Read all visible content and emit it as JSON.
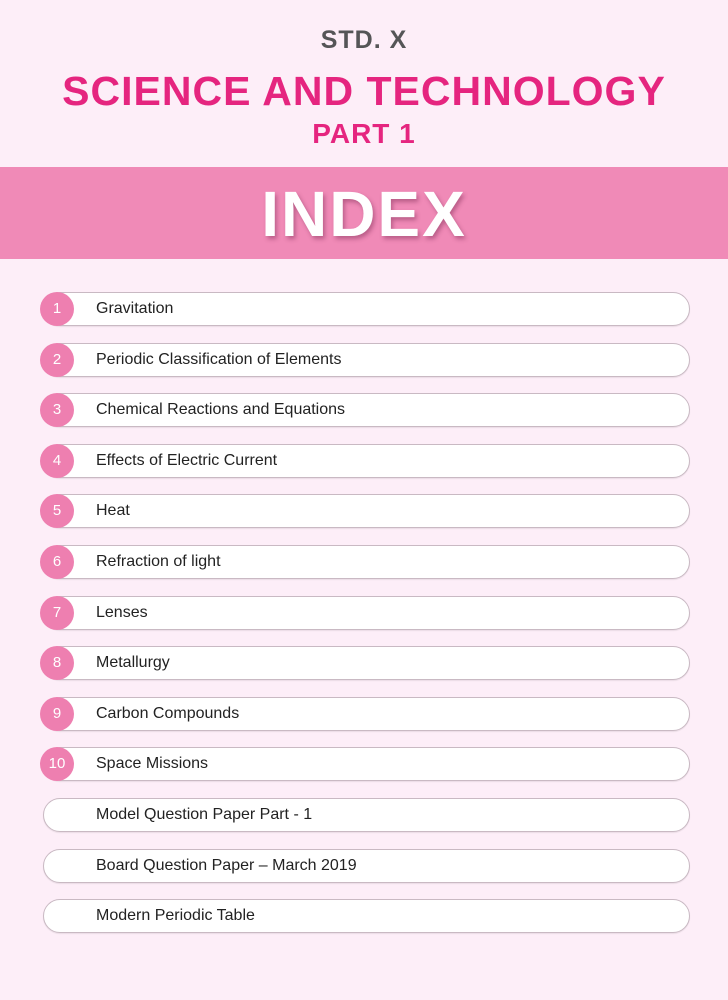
{
  "header": {
    "std": "STD. X",
    "title": "SCIENCE AND TECHNOLOGY",
    "part": "PART 1"
  },
  "banner": {
    "text": "INDEX"
  },
  "chapters": [
    {
      "num": "1",
      "title": "Gravitation"
    },
    {
      "num": "2",
      "title": "Periodic Classification of Elements"
    },
    {
      "num": "3",
      "title": "Chemical Reactions and Equations"
    },
    {
      "num": "4",
      "title": "Effects of Electric Current"
    },
    {
      "num": "5",
      "title": "Heat"
    },
    {
      "num": "6",
      "title": "Refraction of light"
    },
    {
      "num": "7",
      "title": "Lenses"
    },
    {
      "num": "8",
      "title": "Metallurgy"
    },
    {
      "num": "9",
      "title": "Carbon Compounds"
    },
    {
      "num": "10",
      "title": "Space Missions"
    }
  ],
  "extras": [
    {
      "title": "Model Question Paper Part - 1"
    },
    {
      "title": "Board Question Paper – March 2019"
    },
    {
      "title": "Modern Periodic Table"
    }
  ],
  "colors": {
    "accent": "#e5257f",
    "banner": "#f08ab7",
    "badge": "#ee7fb0",
    "background": "#fdeef8"
  }
}
